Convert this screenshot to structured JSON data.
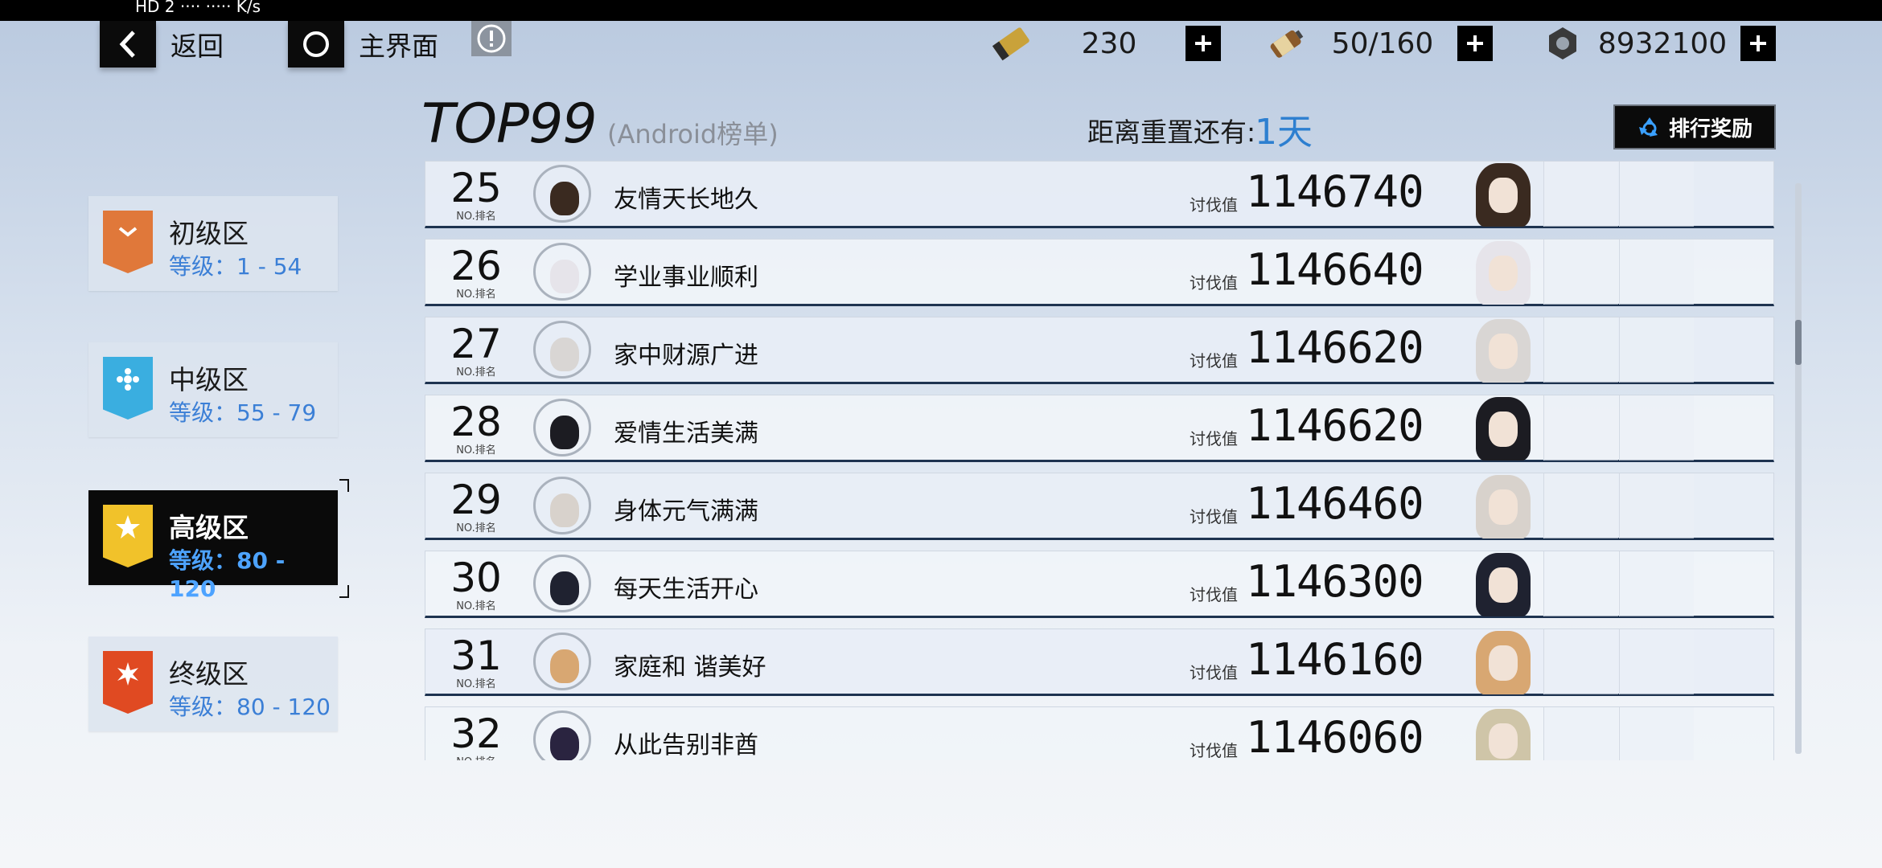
{
  "status_bar": {
    "left_text": "HD 2  ···· ····· K/s"
  },
  "nav": {
    "back_label": "返回",
    "home_label": "主界面",
    "info_icon": "exclamation-icon"
  },
  "currencies": [
    {
      "icon": "ticket-icon",
      "value": "230"
    },
    {
      "icon": "battery-icon",
      "value": "50/160"
    },
    {
      "icon": "gear-nut-icon",
      "value": "8932100"
    }
  ],
  "header": {
    "title": "TOP99",
    "subtitle": "(Android榜单)",
    "reset_label": "距离重置还有:",
    "reset_value": "1天",
    "reward_button": "排行奖励"
  },
  "tiers": [
    {
      "name": "初级区",
      "level": "等级：1 - 54",
      "color": "#e0783a",
      "icon": "chevron-down-icon",
      "active": false
    },
    {
      "name": "中级区",
      "level": "等级：55 - 79",
      "color": "#3aaee0",
      "icon": "flower-icon",
      "active": false
    },
    {
      "name": "高级区",
      "level": "等级：80 - 120",
      "color": "#f1c22a",
      "icon": "star-icon",
      "active": true
    },
    {
      "name": "终级区",
      "level": "等级：80 - 120",
      "color": "#e04a22",
      "icon": "star-burst-icon",
      "active": false
    }
  ],
  "rank_sub_label": "NO.排名",
  "score_label": "讨伐值",
  "rows": [
    {
      "rank": "25",
      "name": "友情天长地久",
      "score": "1146740",
      "hair": "#3a2a20"
    },
    {
      "rank": "26",
      "name": "学业事业顺利",
      "score": "1146640",
      "hair": "#e6e4ea"
    },
    {
      "rank": "27",
      "name": "家中财源广进",
      "score": "1146620",
      "hair": "#d9d6d4"
    },
    {
      "rank": "28",
      "name": "爱情生活美满",
      "score": "1146620",
      "hair": "#1c1c22"
    },
    {
      "rank": "29",
      "name": "身体元气满满",
      "score": "1146460",
      "hair": "#d8d2cc"
    },
    {
      "rank": "30",
      "name": "每天生活开心",
      "score": "1146300",
      "hair": "#1f2230"
    },
    {
      "rank": "31",
      "name": "家庭和 谐美好",
      "score": "1146160",
      "hair": "#d8a772"
    },
    {
      "rank": "32",
      "name": "从此告别非酋",
      "score": "1146060",
      "hair": "#cfc5a8"
    }
  ]
}
